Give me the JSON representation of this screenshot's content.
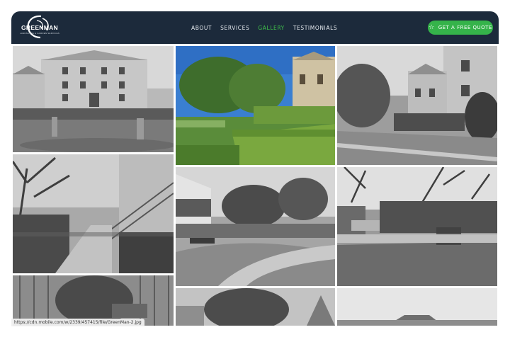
{
  "brand": {
    "name": "GREENMAN",
    "tagline": "LANDSCAPE & GARDEN SERVICES"
  },
  "nav": {
    "items": [
      {
        "label": "ABOUT",
        "active": false
      },
      {
        "label": "SERVICES",
        "active": false
      },
      {
        "label": "GALLERY",
        "active": true
      },
      {
        "label": "TESTIMONIALS",
        "active": false
      }
    ]
  },
  "cta": {
    "label": "GET A FREE QUOTE",
    "icon": "star-icon"
  },
  "gallery": {
    "images": [
      {
        "name": "gallery-image-heritage-building",
        "tone": "grayscale"
      },
      {
        "name": "gallery-image-garden-hedges",
        "tone": "color"
      },
      {
        "name": "gallery-image-lawn-building",
        "tone": "grayscale"
      },
      {
        "name": "gallery-image-path-stairs",
        "tone": "grayscale"
      },
      {
        "name": "gallery-image-courtyard-path",
        "tone": "grayscale"
      },
      {
        "name": "gallery-image-hedge-patio",
        "tone": "grayscale"
      },
      {
        "name": "gallery-image-fence-garden",
        "tone": "grayscale"
      },
      {
        "name": "gallery-image-trees-roof",
        "tone": "grayscale"
      },
      {
        "name": "gallery-image-sky-roofline",
        "tone": "grayscale"
      }
    ]
  },
  "status_bar": {
    "url": "https://cdn.mobile.com/w/2339/457415/file/GreenMan-2.jpg"
  },
  "colors": {
    "header": "#1c2a3b",
    "accent": "#3fc14a",
    "cta": "#35b34a"
  }
}
